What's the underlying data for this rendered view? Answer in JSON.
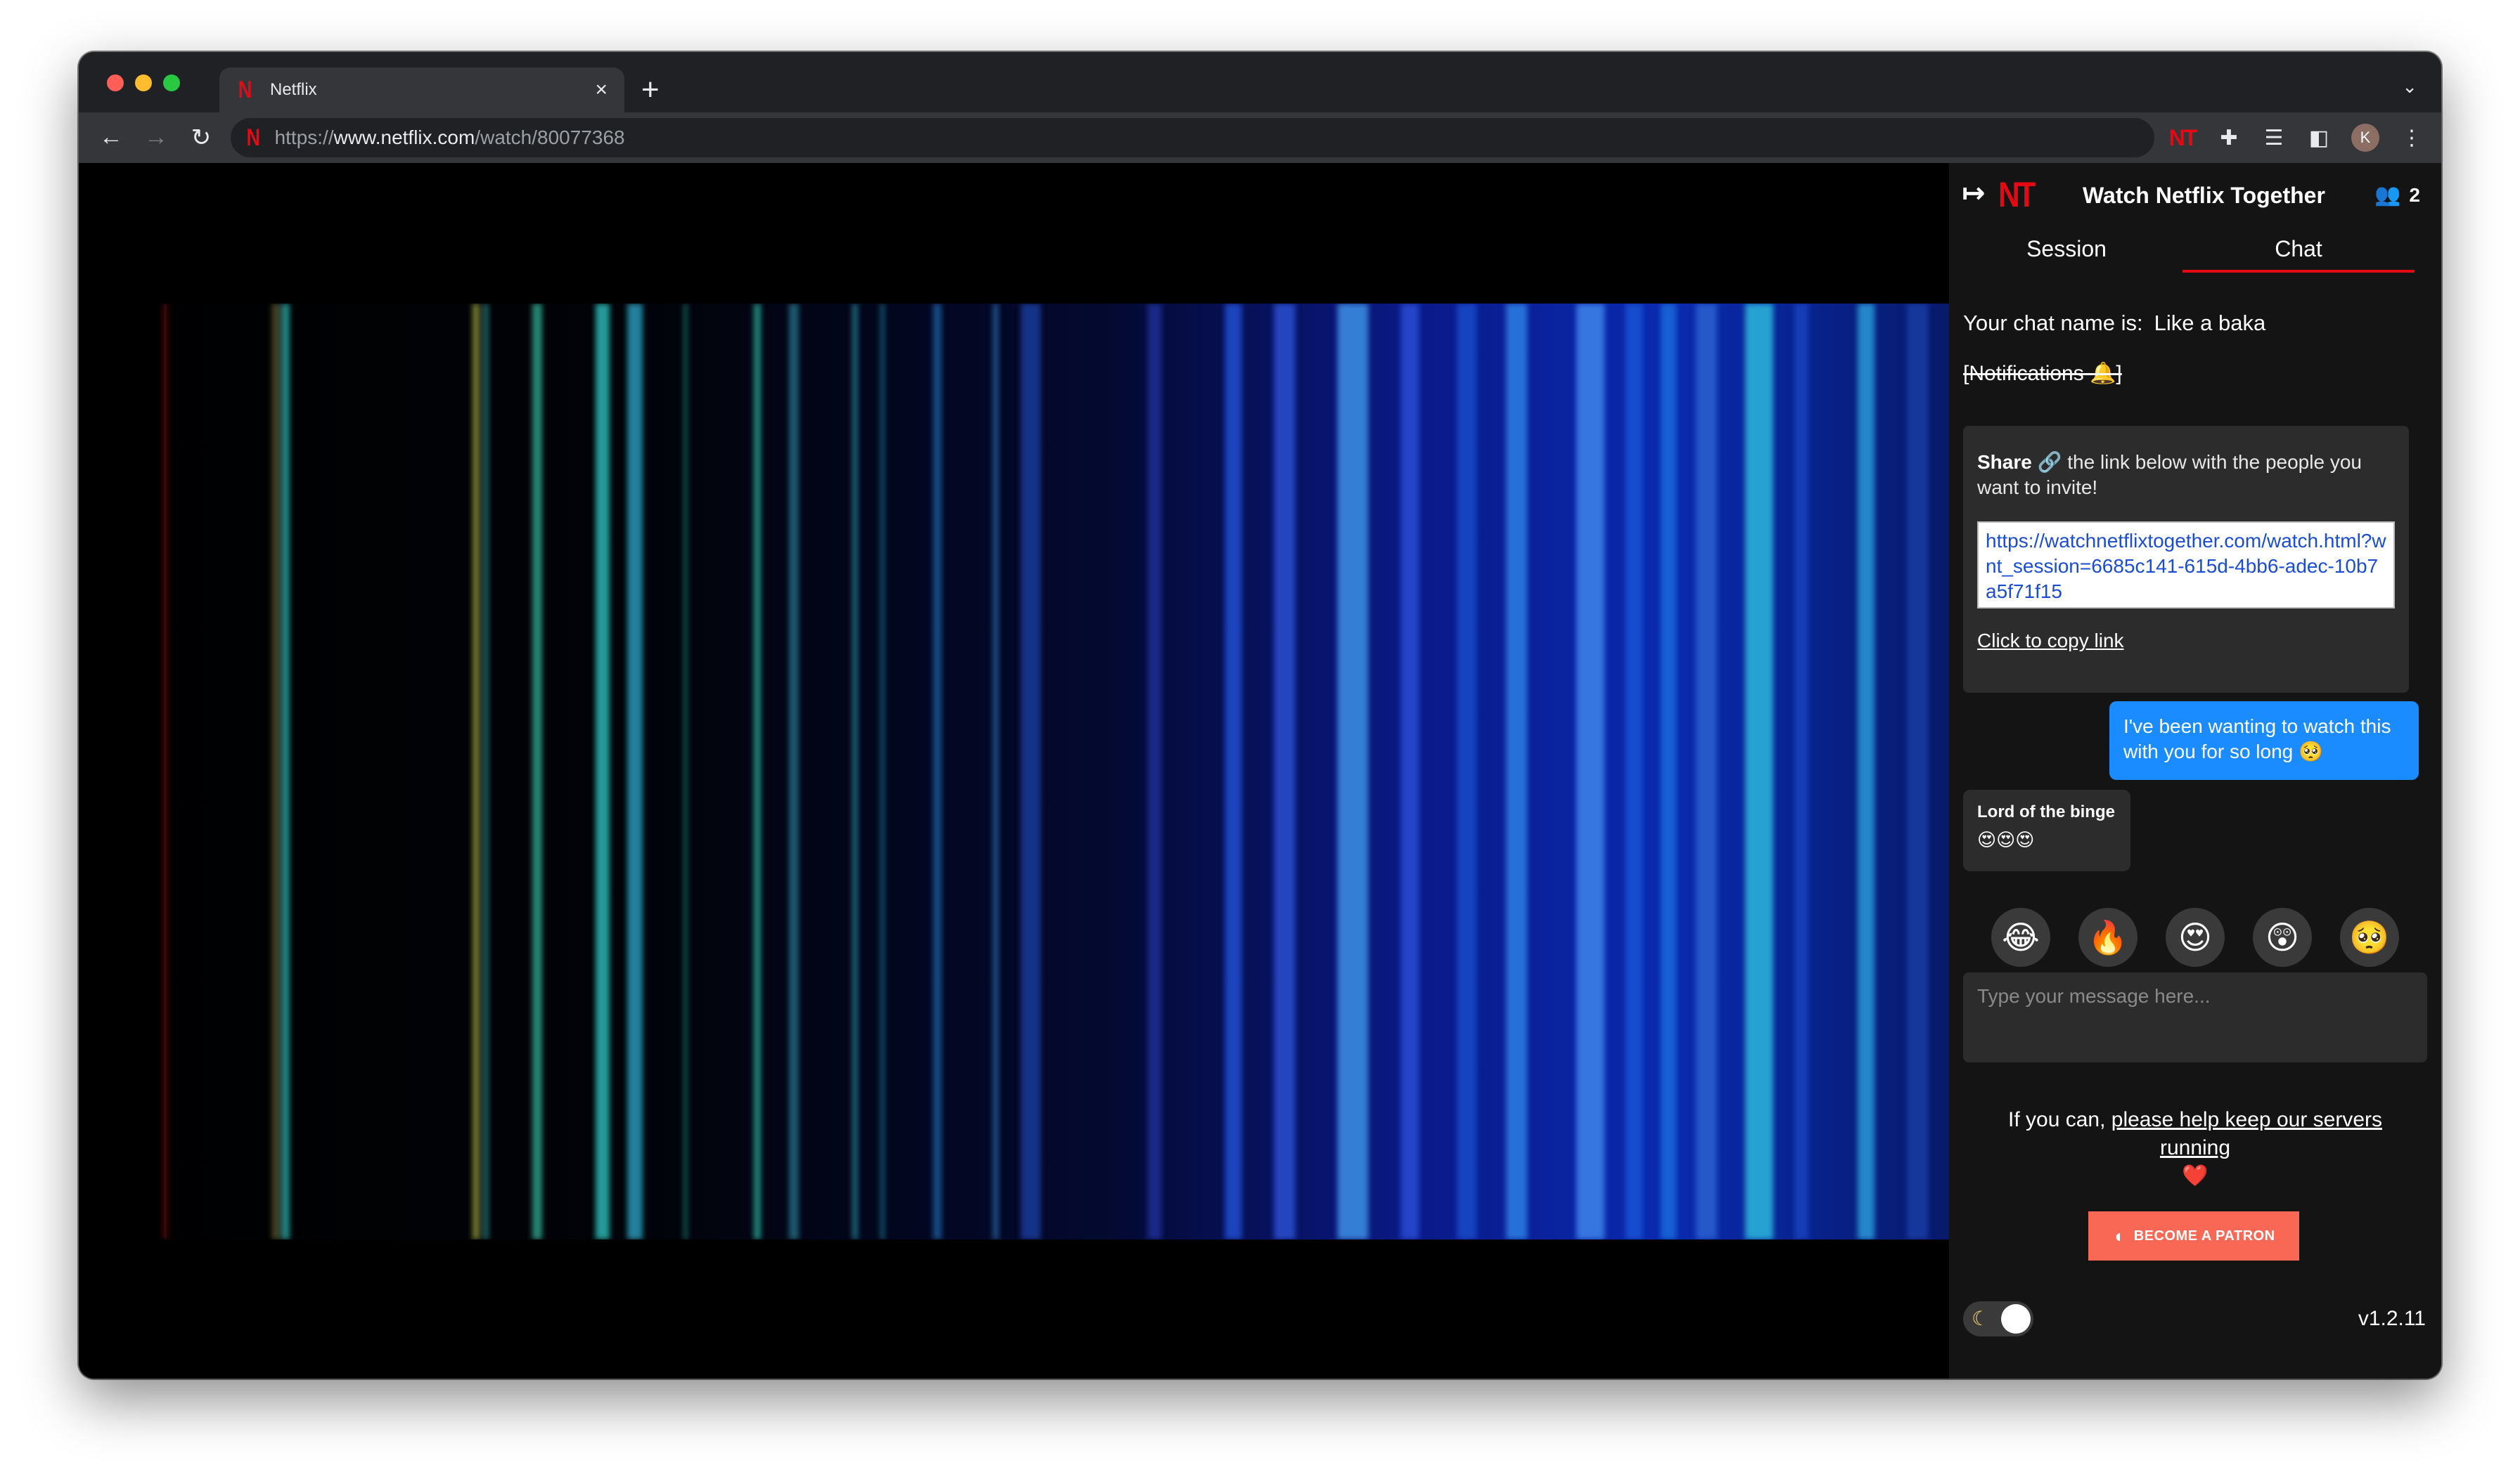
{
  "browser": {
    "tab_title": "Netflix",
    "tab_close": "×",
    "new_tab": "+",
    "tab_menu": "⌄",
    "url_scheme": "https://",
    "url_host": "www.netflix.com",
    "url_path": "/watch/80077368",
    "favicon": "N",
    "ext_nt": "NT",
    "avatar_initial": "K"
  },
  "panel": {
    "logo": "NT",
    "title": "Watch Netflix Together",
    "user_count": "2",
    "tabs": [
      {
        "label": "Session",
        "active": false
      },
      {
        "label": "Chat",
        "active": true
      }
    ],
    "chat_name_label": "Your chat name is:",
    "chat_name": "Like a baka",
    "notifications": "[Notifications 🔔]",
    "share_bold": "Share",
    "share_text": "🔗 the link below with the people you want to invite!",
    "share_url": "https://watchnetflixtogether.com/watch.html?wnt_session=6685c141-615d-4bb6-adec-10b7a5f71f15",
    "copy_link": "Click to copy link",
    "messages": [
      {
        "mine": true,
        "text": "I've been wanting to watch this with you for so long 🥺"
      },
      {
        "mine": false,
        "author": "Lord of the binge",
        "text": "😍😍😍"
      }
    ],
    "reactions": [
      "😂",
      "🔥",
      "😍",
      "😲",
      "🥺"
    ],
    "input_placeholder": "Type your message here...",
    "support_prefix": "If you can,",
    "support_link": "please help keep our servers running",
    "support_heart": "❤️",
    "patron_button": "BECOME A PATRON",
    "version": "v1.2.11"
  },
  "colors": {
    "netflix_red": "#e50914",
    "chat_blue": "#1a8cff",
    "patron_orange": "#f96854"
  }
}
